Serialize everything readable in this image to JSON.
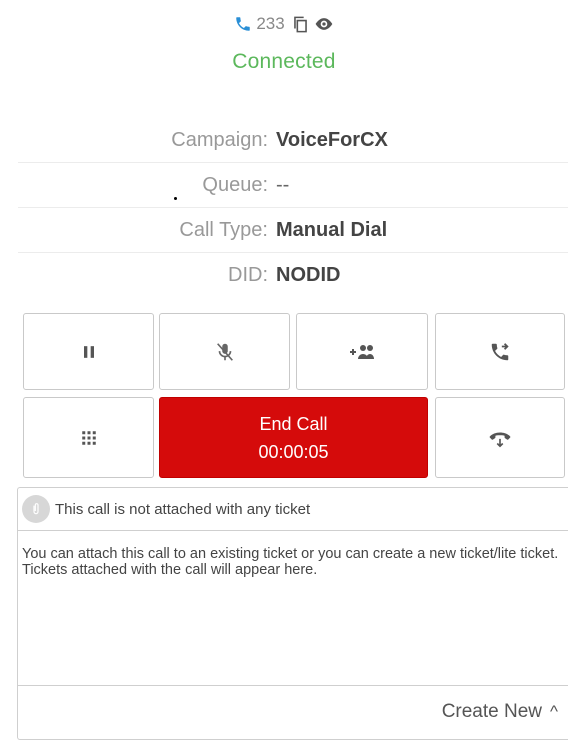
{
  "header": {
    "extension": "233",
    "status": "Connected",
    "status_color": "#5cb85c",
    "icons": [
      "phone-icon",
      "copy-icon",
      "eye-icon"
    ]
  },
  "call_info": {
    "campaign_label": "Campaign:",
    "campaign_value": "VoiceForCX",
    "queue_label": "Queue:",
    "queue_value": "--",
    "call_type_label": "Call Type:",
    "call_type_value": "Manual Dial",
    "did_label": "DID:",
    "did_value": "NODID"
  },
  "controls": {
    "icons": [
      "pause-icon",
      "mute-mic-icon",
      "add-participant-icon",
      "transfer-call-icon",
      "dialpad-icon",
      "hold-call-icon"
    ],
    "end_call_label": "End Call",
    "timer": "00:00:05",
    "end_call_color": "#d50b0b"
  },
  "ticket": {
    "header_text": "This call is not attached with any ticket",
    "body_text": "You can attach this call to an existing ticket or you can create a new ticket/lite ticket. Tickets attached with the call will appear here.",
    "create_label": "Create New",
    "create_caret": "^"
  }
}
